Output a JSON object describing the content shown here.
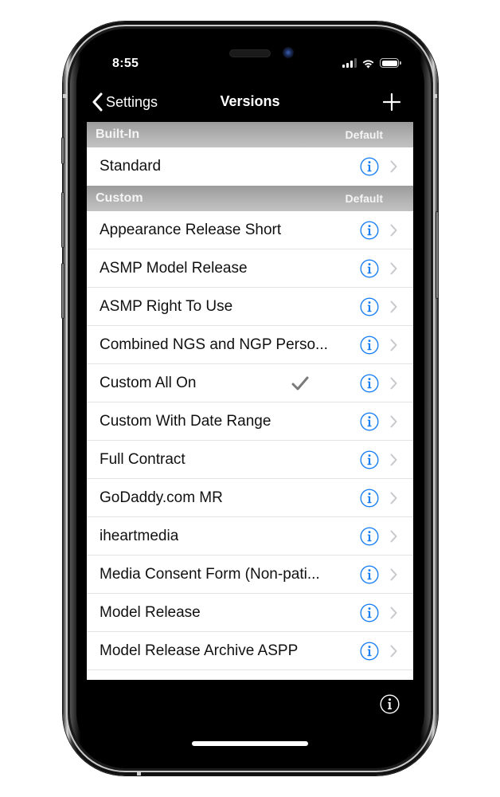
{
  "status_bar": {
    "time": "8:55",
    "icons": [
      "cellular-signal-icon",
      "wifi-icon",
      "battery-icon"
    ]
  },
  "nav": {
    "back_label": "Settings",
    "title": "Versions",
    "add_icon": "plus-icon"
  },
  "sections": [
    {
      "title": "Built-In",
      "default_label": "Default",
      "rows": [
        {
          "label": "Standard",
          "checked": false
        }
      ]
    },
    {
      "title": "Custom",
      "default_label": "Default",
      "rows": [
        {
          "label": "Appearance Release Short",
          "checked": false
        },
        {
          "label": "ASMP Model Release",
          "checked": false
        },
        {
          "label": "ASMP Right To Use",
          "checked": false
        },
        {
          "label": "Combined NGS and NGP Perso...",
          "checked": false
        },
        {
          "label": "Custom All On",
          "checked": true
        },
        {
          "label": "Custom With Date Range",
          "checked": false
        },
        {
          "label": "Full Contract",
          "checked": false
        },
        {
          "label": "GoDaddy.com MR",
          "checked": false
        },
        {
          "label": "iheartmedia",
          "checked": false
        },
        {
          "label": "Media Consent Form (Non-pati...",
          "checked": false
        },
        {
          "label": "Model Release",
          "checked": false
        },
        {
          "label": "Model Release Archive ASPP",
          "checked": false
        },
        {
          "label": "",
          "checked": false
        }
      ]
    }
  ],
  "colors": {
    "accent": "#1a7ff0",
    "chevron": "#c7c7cc",
    "checkmark": "#7a7a7a",
    "section_header_top": "#9b9b9b",
    "section_header_bottom": "#c2c2c2"
  },
  "bottom": {
    "info_icon": "info-circle-icon"
  }
}
